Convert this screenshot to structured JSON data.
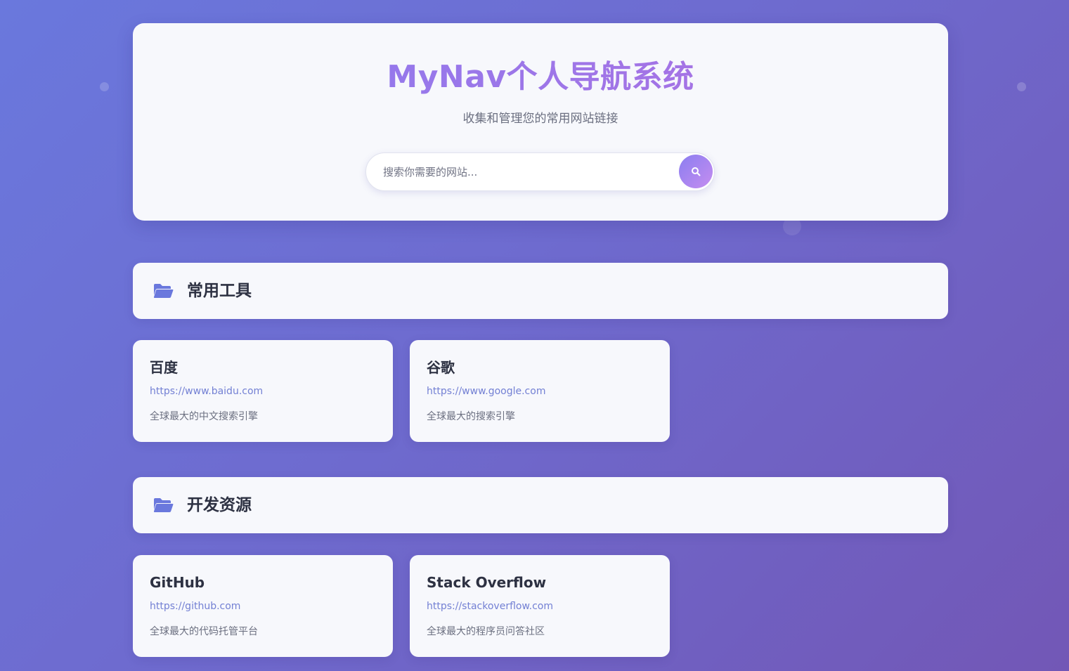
{
  "header": {
    "title": "MyNav个人导航系统",
    "subtitle": "收集和管理您的常用网站链接",
    "search_placeholder": "搜索你需要的网站...",
    "search_icon": "search-icon"
  },
  "colors": {
    "accent": "#8a7cf0",
    "accent_end": "#c58df0",
    "link": "#7380d4",
    "folder": "#6a78dd"
  },
  "sections": [
    {
      "title": "常用工具",
      "icon": "folder-open-icon",
      "links": [
        {
          "name": "百度",
          "url": "https://www.baidu.com",
          "desc": "全球最大的中文搜索引擎"
        },
        {
          "name": "谷歌",
          "url": "https://www.google.com",
          "desc": "全球最大的搜索引擎"
        }
      ]
    },
    {
      "title": "开发资源",
      "icon": "folder-open-icon",
      "links": [
        {
          "name": "GitHub",
          "url": "https://github.com",
          "desc": "全球最大的代码托管平台"
        },
        {
          "name": "Stack Overflow",
          "url": "https://stackoverflow.com",
          "desc": "全球最大的程序员问答社区"
        }
      ]
    }
  ]
}
